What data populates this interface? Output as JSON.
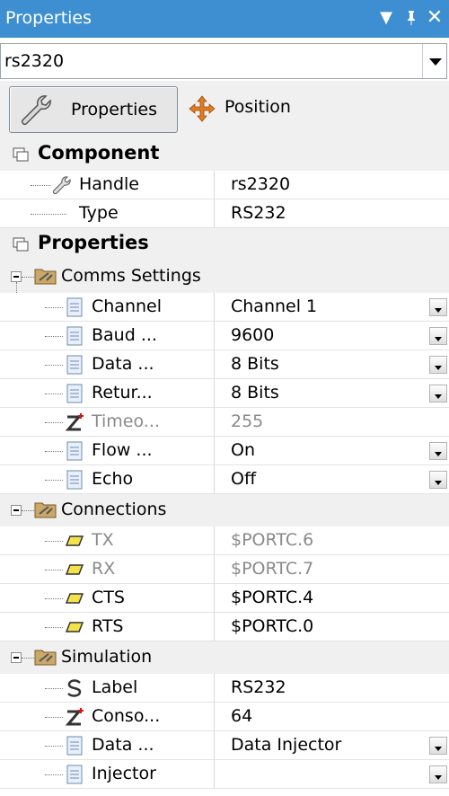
{
  "window": {
    "title": "Properties",
    "controls": {
      "dropdown": "▼",
      "pin": "📌",
      "close": "✕"
    }
  },
  "selector": {
    "value": "rs2320"
  },
  "tabs": [
    {
      "label": "Properties",
      "active": true
    },
    {
      "label": "Position",
      "active": false
    }
  ],
  "sections": {
    "component": {
      "label": "Component",
      "rows": [
        {
          "name": "Handle",
          "value": "rs2320"
        },
        {
          "name": "Type",
          "value": "RS232"
        }
      ]
    },
    "properties": {
      "label": "Properties",
      "groups": {
        "comms": {
          "label": "Comms Settings",
          "rows": [
            {
              "name": "Channel",
              "value": "Channel 1"
            },
            {
              "name": "Baud ...",
              "value": "9600"
            },
            {
              "name": "Data ...",
              "value": "8 Bits"
            },
            {
              "name": "Retur...",
              "value": "8 Bits"
            },
            {
              "name": "Timeo...",
              "value": "255"
            },
            {
              "name": "Flow ...",
              "value": "On"
            },
            {
              "name": "Echo",
              "value": "Off"
            }
          ]
        },
        "connections": {
          "label": "Connections",
          "rows": [
            {
              "name": "TX",
              "value": "$PORTC.6"
            },
            {
              "name": "RX",
              "value": "$PORTC.7"
            },
            {
              "name": "CTS",
              "value": "$PORTC.4"
            },
            {
              "name": "RTS",
              "value": "$PORTC.0"
            }
          ]
        },
        "simulation": {
          "label": "Simulation",
          "rows": [
            {
              "name": "Label",
              "value": "RS232"
            },
            {
              "name": "Conso...",
              "value": "64"
            },
            {
              "name": "Data ...",
              "value": "Data Injector"
            },
            {
              "name": "Injector",
              "value": ""
            }
          ]
        }
      }
    }
  },
  "colors": {
    "titlebar": "#3e8fd1",
    "panel": "#f0f0f0",
    "disabled_text": "#8a8a8a"
  },
  "icons": {
    "property_row": "list-icon",
    "counter_row": "z-plus-icon",
    "connection_row": "pin-icon",
    "label_row": "s-icon",
    "handle_row": "wrench-icon"
  }
}
